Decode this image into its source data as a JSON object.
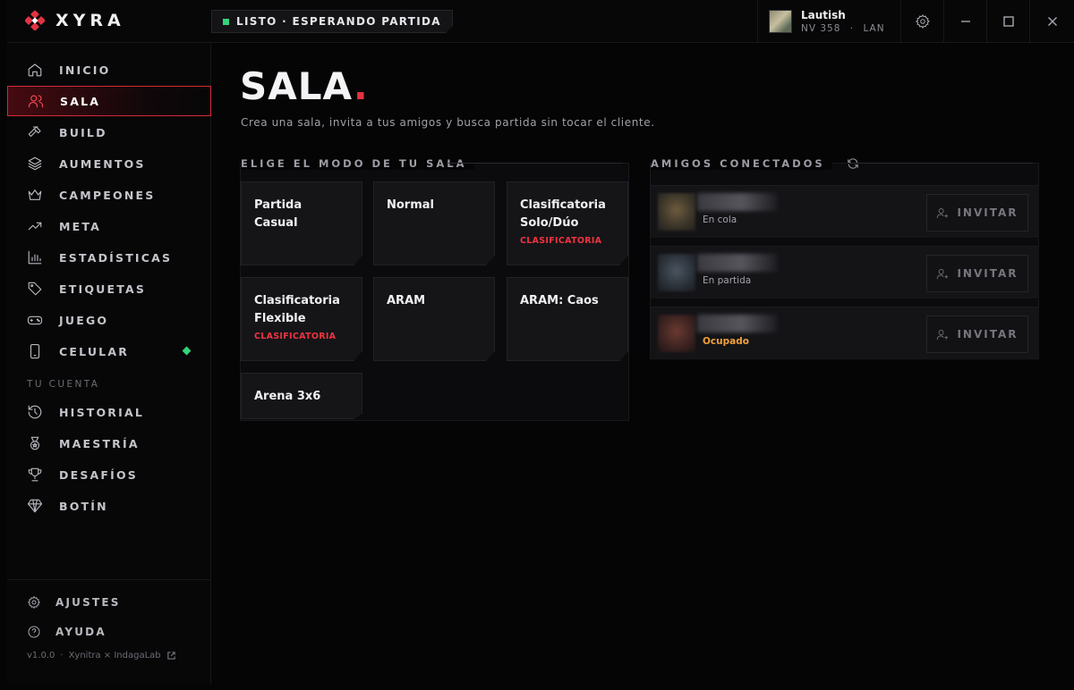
{
  "app": {
    "name": "XYRA"
  },
  "status": {
    "text": "LISTO · ESPERANDO PARTIDA",
    "color": "#34d27a"
  },
  "user": {
    "name": "Lautish",
    "level": "NV 358",
    "separator": "·",
    "region": "LAN"
  },
  "nav": {
    "items": [
      {
        "label": "INICIO",
        "icon": "home-icon"
      },
      {
        "label": "SALA",
        "icon": "users-icon",
        "active": true
      },
      {
        "label": "BUILD",
        "icon": "hammer-icon"
      },
      {
        "label": "AUMENTOS",
        "icon": "layers-icon"
      },
      {
        "label": "CAMPEONES",
        "icon": "crown-icon"
      },
      {
        "label": "META",
        "icon": "trending-icon"
      },
      {
        "label": "ESTADÍSTICAS",
        "icon": "bar-chart-icon"
      },
      {
        "label": "ETIQUETAS",
        "icon": "tag-icon"
      },
      {
        "label": "JUEGO",
        "icon": "gamepad-icon"
      },
      {
        "label": "CELULAR",
        "icon": "phone-icon",
        "badge": true
      }
    ],
    "account_section": "TU CUENTA",
    "account_items": [
      {
        "label": "HISTORIAL",
        "icon": "history-icon"
      },
      {
        "label": "MAESTRÍA",
        "icon": "medal-icon"
      },
      {
        "label": "DESAFÍOS",
        "icon": "trophy-icon"
      },
      {
        "label": "BOTÍN",
        "icon": "diamond-icon"
      }
    ],
    "footer": [
      {
        "label": "AJUSTES",
        "icon": "gear-icon"
      },
      {
        "label": "AYUDA",
        "icon": "help-icon"
      }
    ],
    "version": "v1.0.0",
    "version_sep": "·",
    "credits": "Xynitra × IndagaLab"
  },
  "page": {
    "title": "SALA",
    "title_dot": ".",
    "subtitle": "Crea una sala, invita a tus amigos y busca partida sin tocar el cliente."
  },
  "modes": {
    "title": "ELIGE EL MODO DE TU SALA",
    "items": [
      {
        "name": "Partida Casual",
        "tag": ""
      },
      {
        "name": "Normal",
        "tag": ""
      },
      {
        "name": "Clasificatoria Solo/Dúo",
        "tag": "CLASIFICATORIA"
      },
      {
        "name": "Clasificatoria Flexible",
        "tag": "CLASIFICATORIA"
      },
      {
        "name": "ARAM",
        "tag": ""
      },
      {
        "name": "ARAM: Caos",
        "tag": ""
      },
      {
        "name": "Arena 3x6",
        "tag": ""
      }
    ]
  },
  "friends": {
    "title": "AMIGOS CONECTADOS",
    "invite_label": "INVITAR",
    "items": [
      {
        "status": "En cola",
        "busy": false
      },
      {
        "status": "En partida",
        "busy": false
      },
      {
        "status": "Ocupado",
        "busy": true
      }
    ]
  },
  "colors": {
    "accent": "#e23340",
    "busy": "#f0a23c",
    "online": "#34d27a"
  }
}
